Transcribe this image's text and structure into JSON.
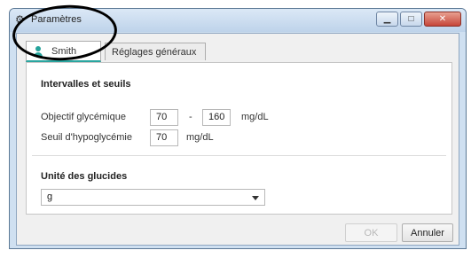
{
  "window": {
    "title": "Paramètres",
    "icon": "gear-icon",
    "controls": {
      "minimize": "▁",
      "maximize": "□",
      "close": "✕"
    }
  },
  "tabs": [
    {
      "label": "Smith",
      "icon": "user-icon",
      "active": true
    },
    {
      "label": "Réglages généraux",
      "active": false
    }
  ],
  "intervals": {
    "title": "Intervalles et seuils",
    "target_label": "Objectif glycémique",
    "target_low": "70",
    "range_separator": "-",
    "target_high": "160",
    "target_unit": "mg/dL",
    "hypo_label": "Seuil d'hypoglycémie",
    "hypo_value": "70",
    "hypo_unit": "mg/dL"
  },
  "carb_unit": {
    "title": "Unité des glucides",
    "selected": "g"
  },
  "buttons": {
    "ok": "OK",
    "cancel": "Annuler"
  },
  "colors": {
    "accent": "#25a39b",
    "annotation": "#000000"
  }
}
